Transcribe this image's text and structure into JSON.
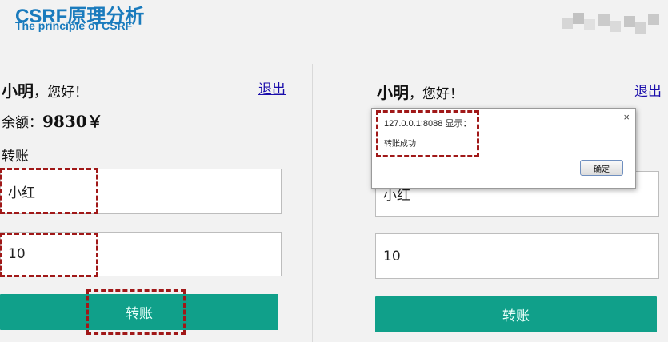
{
  "header": {
    "title": "CSRF原理分析",
    "subtitle": "The principle of CSRF"
  },
  "left_panel": {
    "user_name": "小明",
    "greeting": "，您好！",
    "logout": "退出",
    "balance_label": "余额：",
    "balance_value": "9830￥",
    "transfer_label": "转账",
    "recipient_value": "小红",
    "amount_value": "10",
    "transfer_button": "转账"
  },
  "right_panel": {
    "user_name": "小明",
    "greeting": "，您好！",
    "logout": "退出",
    "recipient_value": "小红",
    "amount_value": "10",
    "transfer_button": "转账"
  },
  "alert_dialog": {
    "title": "127.0.0.1:8088 显示：",
    "message": "转账成功",
    "ok_button": "确定",
    "close_icon": "close-icon"
  },
  "colors": {
    "title_blue": "#1a7bbd",
    "button_teal": "#10a08a",
    "highlight_red": "#a01818",
    "link": "#1a0dab"
  }
}
